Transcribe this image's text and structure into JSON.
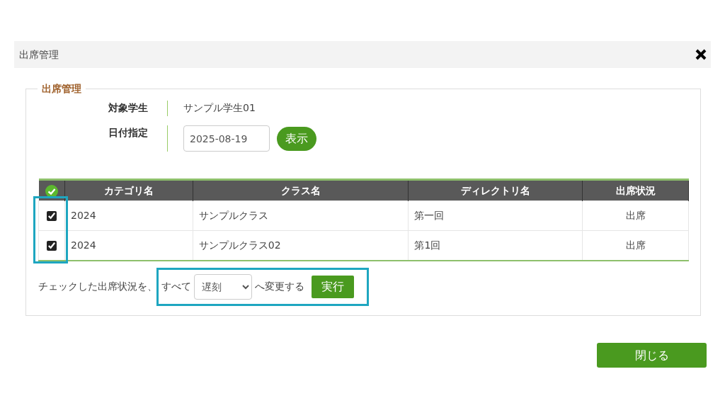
{
  "window": {
    "title": "出席管理"
  },
  "panel": {
    "legend": "出席管理",
    "fields": [
      {
        "kind": "text",
        "label": "対象学生",
        "value": "サンプル学生01"
      },
      {
        "kind": "date",
        "label": "日付指定",
        "value": "2025-08-19",
        "button": "表示"
      }
    ]
  },
  "table": {
    "columns": [
      "カテゴリ名",
      "クラス名",
      "ディレクトリ名",
      "出席状況"
    ],
    "checkbox_column_highlighted": true,
    "rows": [
      {
        "checked": true,
        "cells": [
          "2024",
          "サンプルクラス",
          "第一回",
          "出席"
        ]
      },
      {
        "checked": true,
        "cells": [
          "2024",
          "サンプルクラス02",
          "第1回",
          "出席"
        ]
      }
    ]
  },
  "bulk_action": {
    "prefix": "チェックした出席状況を、",
    "highlighted": true,
    "all_label": "すべて",
    "select_value": "遅刻",
    "suffix": "へ変更する",
    "button": "実行"
  },
  "footer": {
    "close_button": "閉じる"
  }
}
